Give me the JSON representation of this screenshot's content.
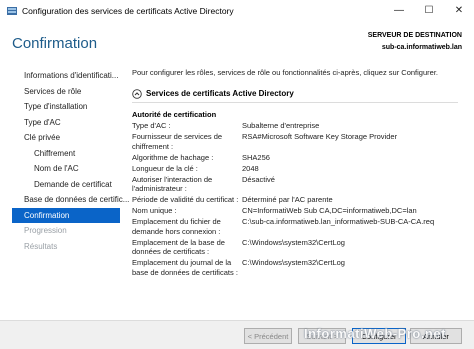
{
  "window": {
    "title": "Configuration des services de certificats Active Directory",
    "controls": {
      "minimize": "—",
      "maximize": "☐",
      "close": "✕"
    }
  },
  "header": {
    "title": "Confirmation",
    "destination_label": "SERVEUR DE DESTINATION",
    "destination_value": "sub-ca.informatiweb.lan"
  },
  "nav": {
    "items": [
      {
        "label": "Informations d'identificati...",
        "state": "normal"
      },
      {
        "label": "Services de rôle",
        "state": "normal"
      },
      {
        "label": "Type d'installation",
        "state": "normal"
      },
      {
        "label": "Type d'AC",
        "state": "normal"
      },
      {
        "label": "Clé privée",
        "state": "normal"
      },
      {
        "label": "Chiffrement",
        "state": "sub"
      },
      {
        "label": "Nom de l'AC",
        "state": "sub"
      },
      {
        "label": "Demande de certificat",
        "state": "sub"
      },
      {
        "label": "Base de données de certific...",
        "state": "normal"
      },
      {
        "label": "Confirmation",
        "state": "active"
      },
      {
        "label": "Progression",
        "state": "disabled"
      },
      {
        "label": "Résultats",
        "state": "disabled"
      }
    ]
  },
  "content": {
    "intro": "Pour configurer les rôles, services de rôle ou fonctionnalités ci-après, cliquez sur Configurer.",
    "section_title": "Services de certificats Active Directory",
    "authority_title": "Autorité de certification",
    "rows": [
      {
        "label": "Type d'AC :",
        "value": "Subalterne d'entreprise"
      },
      {
        "label": "Fournisseur de services de chiffrement :",
        "value": "RSA#Microsoft Software Key Storage Provider"
      },
      {
        "label": "Algorithme de hachage :",
        "value": "SHA256"
      },
      {
        "label": "Longueur de la clé :",
        "value": "2048"
      },
      {
        "label": "Autoriser l'interaction de l'administrateur :",
        "value": "Désactivé"
      },
      {
        "label": "Période de validité du certificat :",
        "value": "Déterminé par l'AC parente"
      },
      {
        "label": "Nom unique :",
        "value": "CN=InformatiWeb Sub CA,DC=informatiweb,DC=lan"
      },
      {
        "label": "Emplacement du fichier de demande hors connexion :",
        "value": "C:\\sub-ca.informatiweb.lan_informatiweb-SUB-CA-CA.req"
      },
      {
        "label": "Emplacement de la base de données de certificats :",
        "value": "C:\\Windows\\system32\\CertLog"
      },
      {
        "label": "Emplacement du journal de la base de données de certificats :",
        "value": "C:\\Windows\\system32\\CertLog"
      }
    ]
  },
  "footer": {
    "prev": "< Précédent",
    "next": "Suivant >",
    "configure": "Configurer",
    "cancel": "Annuler"
  },
  "watermark": "InformatiWeb-Pro.net",
  "colors": {
    "accent": "#0a64c8",
    "title": "#1e5c8a"
  }
}
